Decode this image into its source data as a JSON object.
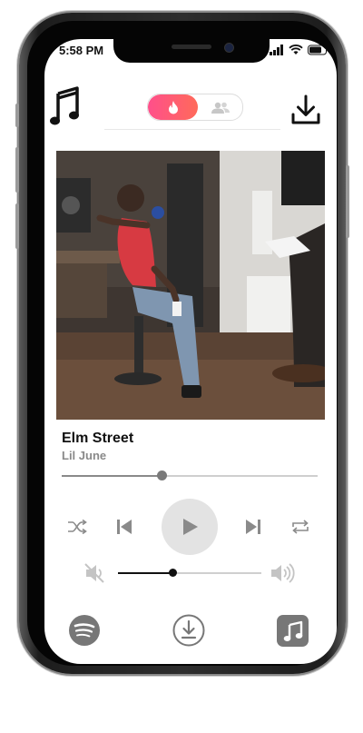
{
  "status": {
    "time": "5:58 PM"
  },
  "header": {
    "app_icon": "music-note-icon",
    "mode_toggle": {
      "active_icon": "flame-icon",
      "inactive_icon": "group-icon",
      "active_color": "#ff5577"
    },
    "download_icon": "download-icon"
  },
  "track": {
    "title": "Elm Street",
    "artist": "Lil June",
    "progress_fraction": 0.39
  },
  "controls": {
    "shuffle_icon": "shuffle-icon",
    "previous_icon": "skip-previous-icon",
    "play_icon": "play-icon",
    "next_icon": "skip-next-icon",
    "repeat_icon": "repeat-icon"
  },
  "volume": {
    "level_fraction": 0.38,
    "mute_icon": "volume-mute-icon",
    "max_icon": "volume-up-icon"
  },
  "bottom_nav": [
    "spotify-icon",
    "download-circle-icon",
    "apple-music-icon"
  ]
}
